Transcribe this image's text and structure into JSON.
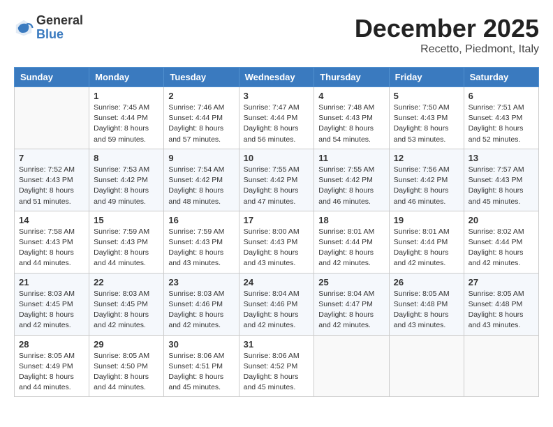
{
  "logo": {
    "line1": "General",
    "line2": "Blue"
  },
  "title": "December 2025",
  "location": "Recetto, Piedmont, Italy",
  "days_header": [
    "Sunday",
    "Monday",
    "Tuesday",
    "Wednesday",
    "Thursday",
    "Friday",
    "Saturday"
  ],
  "weeks": [
    [
      {
        "day": "",
        "info": ""
      },
      {
        "day": "1",
        "info": "Sunrise: 7:45 AM\nSunset: 4:44 PM\nDaylight: 8 hours\nand 59 minutes."
      },
      {
        "day": "2",
        "info": "Sunrise: 7:46 AM\nSunset: 4:44 PM\nDaylight: 8 hours\nand 57 minutes."
      },
      {
        "day": "3",
        "info": "Sunrise: 7:47 AM\nSunset: 4:44 PM\nDaylight: 8 hours\nand 56 minutes."
      },
      {
        "day": "4",
        "info": "Sunrise: 7:48 AM\nSunset: 4:43 PM\nDaylight: 8 hours\nand 54 minutes."
      },
      {
        "day": "5",
        "info": "Sunrise: 7:50 AM\nSunset: 4:43 PM\nDaylight: 8 hours\nand 53 minutes."
      },
      {
        "day": "6",
        "info": "Sunrise: 7:51 AM\nSunset: 4:43 PM\nDaylight: 8 hours\nand 52 minutes."
      }
    ],
    [
      {
        "day": "7",
        "info": "Sunrise: 7:52 AM\nSunset: 4:43 PM\nDaylight: 8 hours\nand 51 minutes."
      },
      {
        "day": "8",
        "info": "Sunrise: 7:53 AM\nSunset: 4:42 PM\nDaylight: 8 hours\nand 49 minutes."
      },
      {
        "day": "9",
        "info": "Sunrise: 7:54 AM\nSunset: 4:42 PM\nDaylight: 8 hours\nand 48 minutes."
      },
      {
        "day": "10",
        "info": "Sunrise: 7:55 AM\nSunset: 4:42 PM\nDaylight: 8 hours\nand 47 minutes."
      },
      {
        "day": "11",
        "info": "Sunrise: 7:55 AM\nSunset: 4:42 PM\nDaylight: 8 hours\nand 46 minutes."
      },
      {
        "day": "12",
        "info": "Sunrise: 7:56 AM\nSunset: 4:42 PM\nDaylight: 8 hours\nand 46 minutes."
      },
      {
        "day": "13",
        "info": "Sunrise: 7:57 AM\nSunset: 4:43 PM\nDaylight: 8 hours\nand 45 minutes."
      }
    ],
    [
      {
        "day": "14",
        "info": "Sunrise: 7:58 AM\nSunset: 4:43 PM\nDaylight: 8 hours\nand 44 minutes."
      },
      {
        "day": "15",
        "info": "Sunrise: 7:59 AM\nSunset: 4:43 PM\nDaylight: 8 hours\nand 44 minutes."
      },
      {
        "day": "16",
        "info": "Sunrise: 7:59 AM\nSunset: 4:43 PM\nDaylight: 8 hours\nand 43 minutes."
      },
      {
        "day": "17",
        "info": "Sunrise: 8:00 AM\nSunset: 4:43 PM\nDaylight: 8 hours\nand 43 minutes."
      },
      {
        "day": "18",
        "info": "Sunrise: 8:01 AM\nSunset: 4:44 PM\nDaylight: 8 hours\nand 42 minutes."
      },
      {
        "day": "19",
        "info": "Sunrise: 8:01 AM\nSunset: 4:44 PM\nDaylight: 8 hours\nand 42 minutes."
      },
      {
        "day": "20",
        "info": "Sunrise: 8:02 AM\nSunset: 4:44 PM\nDaylight: 8 hours\nand 42 minutes."
      }
    ],
    [
      {
        "day": "21",
        "info": "Sunrise: 8:03 AM\nSunset: 4:45 PM\nDaylight: 8 hours\nand 42 minutes."
      },
      {
        "day": "22",
        "info": "Sunrise: 8:03 AM\nSunset: 4:45 PM\nDaylight: 8 hours\nand 42 minutes."
      },
      {
        "day": "23",
        "info": "Sunrise: 8:03 AM\nSunset: 4:46 PM\nDaylight: 8 hours\nand 42 minutes."
      },
      {
        "day": "24",
        "info": "Sunrise: 8:04 AM\nSunset: 4:46 PM\nDaylight: 8 hours\nand 42 minutes."
      },
      {
        "day": "25",
        "info": "Sunrise: 8:04 AM\nSunset: 4:47 PM\nDaylight: 8 hours\nand 42 minutes."
      },
      {
        "day": "26",
        "info": "Sunrise: 8:05 AM\nSunset: 4:48 PM\nDaylight: 8 hours\nand 43 minutes."
      },
      {
        "day": "27",
        "info": "Sunrise: 8:05 AM\nSunset: 4:48 PM\nDaylight: 8 hours\nand 43 minutes."
      }
    ],
    [
      {
        "day": "28",
        "info": "Sunrise: 8:05 AM\nSunset: 4:49 PM\nDaylight: 8 hours\nand 44 minutes."
      },
      {
        "day": "29",
        "info": "Sunrise: 8:05 AM\nSunset: 4:50 PM\nDaylight: 8 hours\nand 44 minutes."
      },
      {
        "day": "30",
        "info": "Sunrise: 8:06 AM\nSunset: 4:51 PM\nDaylight: 8 hours\nand 45 minutes."
      },
      {
        "day": "31",
        "info": "Sunrise: 8:06 AM\nSunset: 4:52 PM\nDaylight: 8 hours\nand 45 minutes."
      },
      {
        "day": "",
        "info": ""
      },
      {
        "day": "",
        "info": ""
      },
      {
        "day": "",
        "info": ""
      }
    ]
  ]
}
